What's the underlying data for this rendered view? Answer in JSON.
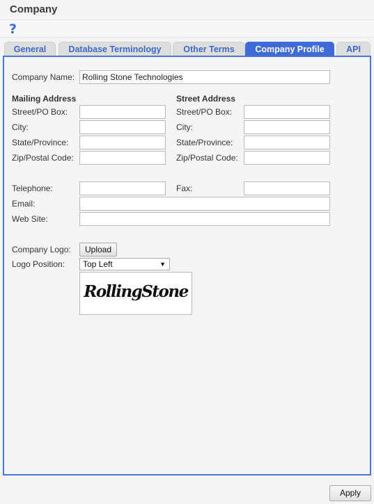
{
  "window": {
    "title": "Company"
  },
  "help": {
    "glyph": "?"
  },
  "tabs": [
    {
      "label": "General"
    },
    {
      "label": "Database Terminology"
    },
    {
      "label": "Other Terms"
    },
    {
      "label": "Company Profile"
    },
    {
      "label": "API"
    }
  ],
  "active_tab": "Company Profile",
  "form": {
    "company_name_label": "Company Name:",
    "company_name_value": "Rolling Stone Technologies",
    "mailing": {
      "heading": "Mailing Address",
      "street_label": "Street/PO Box:",
      "city_label": "City:",
      "state_label": "State/Province:",
      "zip_label": "Zip/Postal Code:",
      "street_value": "",
      "city_value": "",
      "state_value": "",
      "zip_value": ""
    },
    "street": {
      "heading": "Street Address",
      "street_label": "Street/PO Box:",
      "city_label": "City:",
      "state_label": "State/Province:",
      "zip_label": "Zip/Postal Code:",
      "street_value": "",
      "city_value": "",
      "state_value": "",
      "zip_value": ""
    },
    "telephone_label": "Telephone:",
    "telephone_value": "",
    "fax_label": "Fax:",
    "fax_value": "",
    "email_label": "Email:",
    "email_value": "",
    "website_label": "Web Site:",
    "website_value": "",
    "logo_label": "Company Logo:",
    "upload_label": "Upload",
    "logo_position_label": "Logo Position:",
    "logo_position_value": "Top Left",
    "logo_image_text": "RollingStone"
  },
  "footer": {
    "apply_label": "Apply"
  },
  "colors": {
    "accent": "#3f6bd6",
    "tab_text": "#3e68c7",
    "help": "#3a6ad8"
  }
}
